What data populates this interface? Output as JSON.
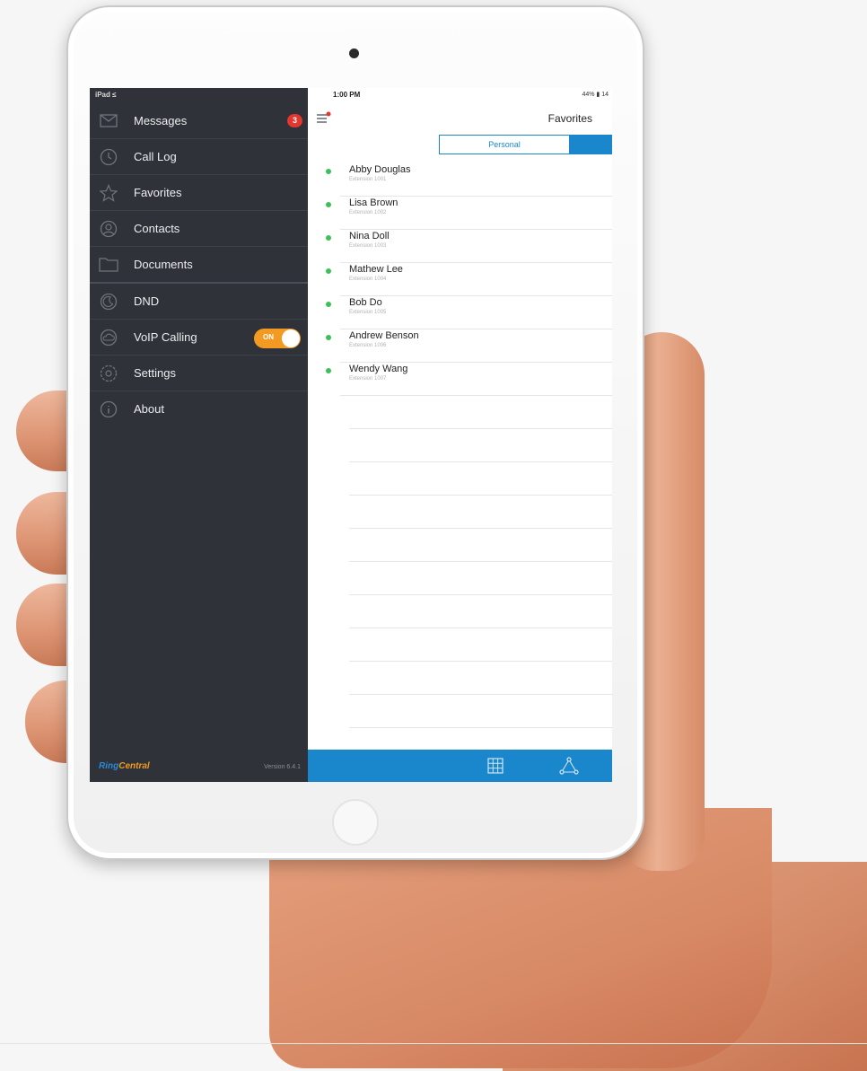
{
  "status_bar": {
    "carrier": "iPad ≤",
    "time": "1:00 PM",
    "battery": "44% ▮ 14"
  },
  "sidebar": {
    "items": [
      {
        "label": "Messages",
        "icon": "envelope-icon",
        "badge": "3"
      },
      {
        "label": "Call Log",
        "icon": "clock-icon"
      },
      {
        "label": "Favorites",
        "icon": "star-icon"
      },
      {
        "label": "Contacts",
        "icon": "person-icon"
      },
      {
        "label": "Documents",
        "icon": "folder-icon"
      },
      {
        "label": "DND",
        "icon": "moon-icon"
      },
      {
        "label": "VoIP Calling",
        "icon": "cloud-icon",
        "toggle": "ON"
      },
      {
        "label": "Settings",
        "icon": "gear-icon"
      },
      {
        "label": "About",
        "icon": "info-icon"
      }
    ],
    "brand": {
      "part1": "Ring",
      "part2": "Central"
    },
    "version": "Version 6.4.1"
  },
  "main": {
    "title": "Favorites",
    "segments": {
      "personal": "Personal"
    },
    "contacts": [
      {
        "name": "Abby Douglas",
        "sub": "Extension 1001"
      },
      {
        "name": "Lisa Brown",
        "sub": "Extension 1002"
      },
      {
        "name": "Nina Doll",
        "sub": "Extension 1003"
      },
      {
        "name": "Mathew Lee",
        "sub": "Extension 1004"
      },
      {
        "name": "Bob Do",
        "sub": "Extension 1005"
      },
      {
        "name": "Andrew Benson",
        "sub": "Extension 1006"
      },
      {
        "name": "Wendy Wang",
        "sub": "Extension 1007"
      }
    ],
    "bottom_icons": [
      "keypad-icon",
      "network-icon"
    ]
  },
  "colors": {
    "sidebar_bg": "#2f3238",
    "accent_blue": "#1a86cc",
    "toggle_orange": "#f39a22",
    "badge_red": "#e2362e",
    "presence_green": "#3bc15a"
  }
}
